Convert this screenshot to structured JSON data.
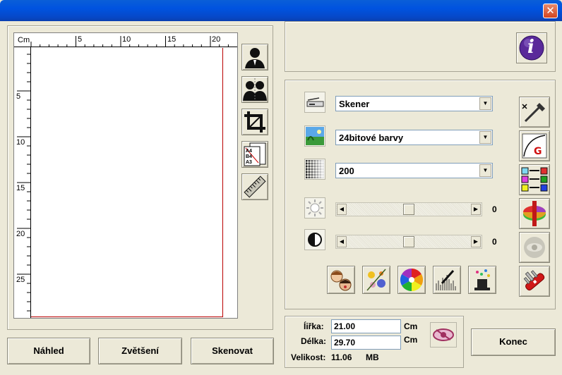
{
  "window": {
    "close_glyph": "✕"
  },
  "preview": {
    "ruler_unit": "Cm",
    "top_ticks": [
      "5",
      "10",
      "15",
      "20"
    ],
    "left_ticks": [
      "5",
      "10",
      "15",
      "20",
      "25"
    ]
  },
  "side_tools": [
    "person-icon",
    "two-people-icon",
    "crop-icon",
    "paper-size-icon",
    "ruler-icon"
  ],
  "paper_sizes": {
    "a4": "A4",
    "b4": "B4",
    "a3": "A3"
  },
  "buttons": {
    "preview": "Náhled",
    "zoom": "Zvětšení",
    "scan": "Skenovat",
    "exit": "Konec"
  },
  "info": {
    "icon_letter": "i"
  },
  "settings": {
    "source": "Skener",
    "color_mode": "24bitové barvy",
    "resolution": "200",
    "brightness": {
      "value": "0",
      "level": 0.5
    },
    "contrast": {
      "value": "0",
      "level": 0.5
    },
    "dropdown_arrow": "▼",
    "slider_left": "◀",
    "slider_right": "▶"
  },
  "tools": [
    "eyedropper-icon",
    "gamma-curve-icon",
    "color-balance-icon",
    "hue-wheel-icon",
    "eye-disabled-icon",
    "multitool-icon"
  ],
  "effects": [
    "face-icon",
    "flowers-icon",
    "color-wheel-icon",
    "dropper-histogram-icon",
    "magic-hat-icon"
  ],
  "size": {
    "width_label": "Íiřka:",
    "width_value": "21.00",
    "height_label": "Délka:",
    "height_value": "29.70",
    "unit": "Cm",
    "filesize_label": "Velikost:",
    "filesize_value": "11.06",
    "filesize_unit": "MB"
  },
  "colors": {
    "titlebar": "#0053e0",
    "page_border": "#bb0000",
    "dialog_bg": "#ece9d8"
  }
}
